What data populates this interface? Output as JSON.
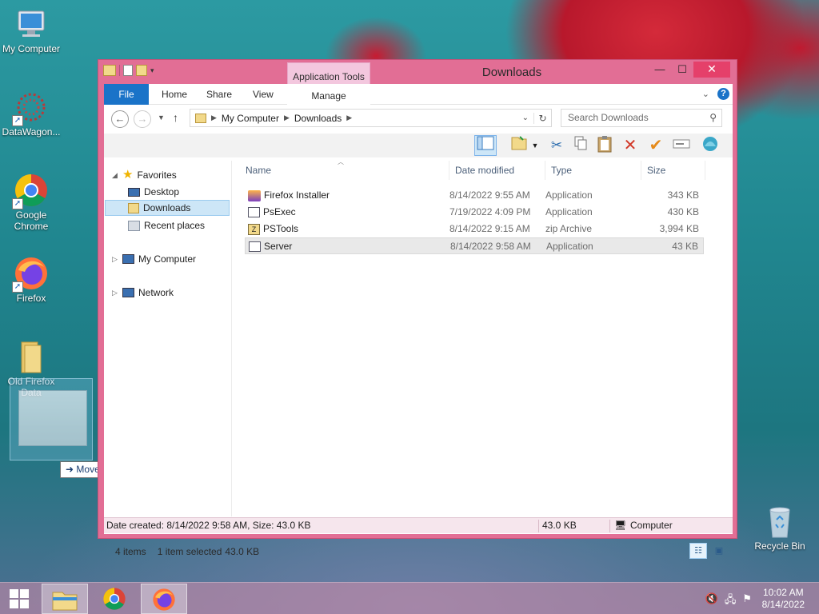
{
  "desktop": {
    "icons": [
      {
        "label": "My Computer"
      },
      {
        "label": "DataWagon..."
      },
      {
        "label": "Google Chrome"
      },
      {
        "label": "Firefox"
      },
      {
        "label": "Old Firefox Data"
      },
      {
        "label": "Recycle Bin"
      }
    ]
  },
  "drag": {
    "tooltip": "Move to Desktop"
  },
  "window": {
    "title": "Downloads",
    "context_tab_group": "Application Tools",
    "ribbon_tabs": [
      "File",
      "Home",
      "Share",
      "View",
      "Manage"
    ],
    "address": {
      "root": "My Computer",
      "current": "Downloads"
    },
    "search_placeholder": "Search Downloads",
    "nav": {
      "favorites": "Favorites",
      "desktop": "Desktop",
      "downloads": "Downloads",
      "recent": "Recent places",
      "computer": "My Computer",
      "network": "Network"
    },
    "columns": [
      "Name",
      "Date modified",
      "Type",
      "Size"
    ],
    "files": [
      {
        "name": "Firefox Installer",
        "date": "8/14/2022 9:55 AM",
        "type": "Application",
        "size": "343 KB"
      },
      {
        "name": "PsExec",
        "date": "7/19/2022 4:09 PM",
        "type": "Application",
        "size": "430 KB"
      },
      {
        "name": "PSTools",
        "date": "8/14/2022 9:15 AM",
        "type": "zip Archive",
        "size": "3,994 KB"
      },
      {
        "name": "Server",
        "date": "8/14/2022 9:58 AM",
        "type": "Application",
        "size": "43 KB"
      }
    ],
    "status": {
      "items": "4 items",
      "selected": "1 item selected",
      "selected_size": "43.0 KB"
    },
    "details_bar": {
      "info": "Date created: 8/14/2022 9:58 AM, Size: 43.0 KB",
      "size": "43.0 KB",
      "location": "Computer"
    }
  },
  "taskbar": {
    "time": "10:02 AM",
    "date": "8/14/2022"
  },
  "colors": {
    "window_frame": "#e26e95",
    "accent": "#1a73c8",
    "close": "#e5406a"
  }
}
